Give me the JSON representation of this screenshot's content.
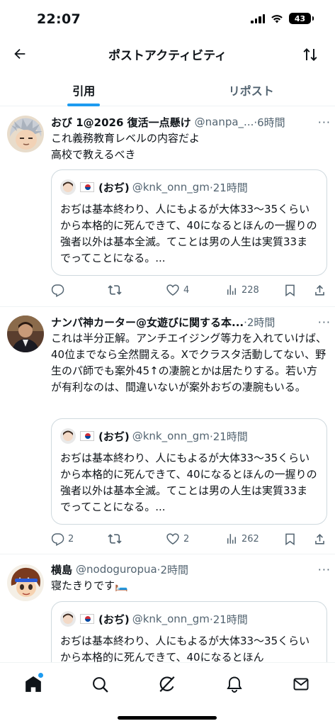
{
  "status_bar": {
    "time": "22:07",
    "battery": "43"
  },
  "header": {
    "title": "ポストアクティビティ"
  },
  "tabs": [
    {
      "label": "引用",
      "active": true
    },
    {
      "label": "リポスト",
      "active": false
    }
  ],
  "quoted_tweet": {
    "name": "(おぢ)",
    "handle": "@knk_onn_gm",
    "time": "·21時間",
    "text": "おぢは基本終わり、人にもよるが大体33〜35くらいから本格的に死んできて、40になるとほんの一握りの強者以外は基本全滅。てことは男の人生は実質33までってことになる。..."
  },
  "posts": [
    {
      "name": "おび 1@2026 復活一点懸け",
      "handle": "@nanpa_...",
      "time": "·6時間",
      "text": "これ義務教育レベルの内容だよ\n高校で教えるべき",
      "actions": {
        "replies": "",
        "reposts": "",
        "likes": "4",
        "views": "228"
      }
    },
    {
      "name": "ナンパ神カーター@女遊びに関する本...",
      "handle": "",
      "time": "·2時間",
      "text": "これは半分正解。アンチエイジング等力を入れていけば、40位までなら全然闘える。Xでクラスタ活動してない、野生のパ師でも案外45↑の凄腕とかは居たりする。若い方が有利なのは、間違いないが案外おぢの凄腕もいる。",
      "actions": {
        "replies": "2",
        "reposts": "",
        "likes": "2",
        "views": "262"
      }
    },
    {
      "name": "横島",
      "handle": "@nodoguropua",
      "time": "·2時間",
      "text": "寝たきりです🛏️",
      "actions": {
        "replies": "",
        "reposts": "",
        "likes": "",
        "views": ""
      }
    }
  ],
  "quoted_tweet_partial_text": "おぢは基本終わり、人にもよるが大体33〜35くらいから本格的に死んできて、40になるとほん",
  "nav": {
    "items": [
      "home-icon",
      "search-icon",
      "grok-icon",
      "notifications-icon",
      "messages-icon"
    ],
    "accent": "#1d9bf0"
  }
}
